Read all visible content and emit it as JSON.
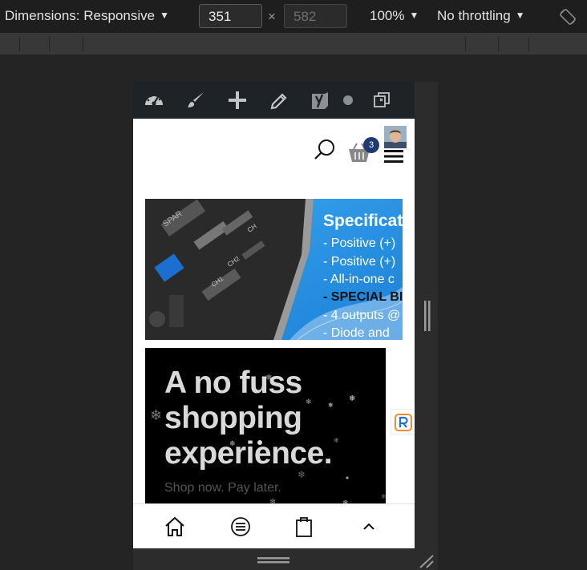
{
  "toolbar": {
    "dimensions_label": "Dimensions: Responsive",
    "width_value": "351",
    "times": "×",
    "height_value": "582",
    "zoom": "100%",
    "throttling": "No throttling",
    "caret": "▼"
  },
  "admin_bar": {
    "icons": [
      "dashboard-icon",
      "customize-brush-icon",
      "add-new-icon",
      "edit-pencil-icon",
      "yoast-seo-icon",
      "status-dot-icon",
      "duplicate-icon"
    ]
  },
  "header": {
    "cart_count": "3"
  },
  "banner1": {
    "title": "Specificat",
    "lines": [
      "- Positive (+)",
      "- Positive (+)",
      "- All-in-one c",
      "- SPECIAL BI",
      "- 4 outputs @",
      "- Diode and"
    ],
    "board_labels": [
      "SPAR",
      "CH",
      "CH2",
      "CH1"
    ]
  },
  "banner2": {
    "headline": "A no fuss shopping experience.",
    "subtext": "Shop now. Pay later."
  },
  "bottom_nav": {
    "items": [
      "home-icon",
      "menu-icon",
      "shopping-bag-icon",
      "chevron-up-icon"
    ]
  },
  "colors": {
    "admin_bar": "#1d2327",
    "badge": "#1e3a74",
    "banner_blue": "#2196e8",
    "devtools_bg": "#242424"
  }
}
